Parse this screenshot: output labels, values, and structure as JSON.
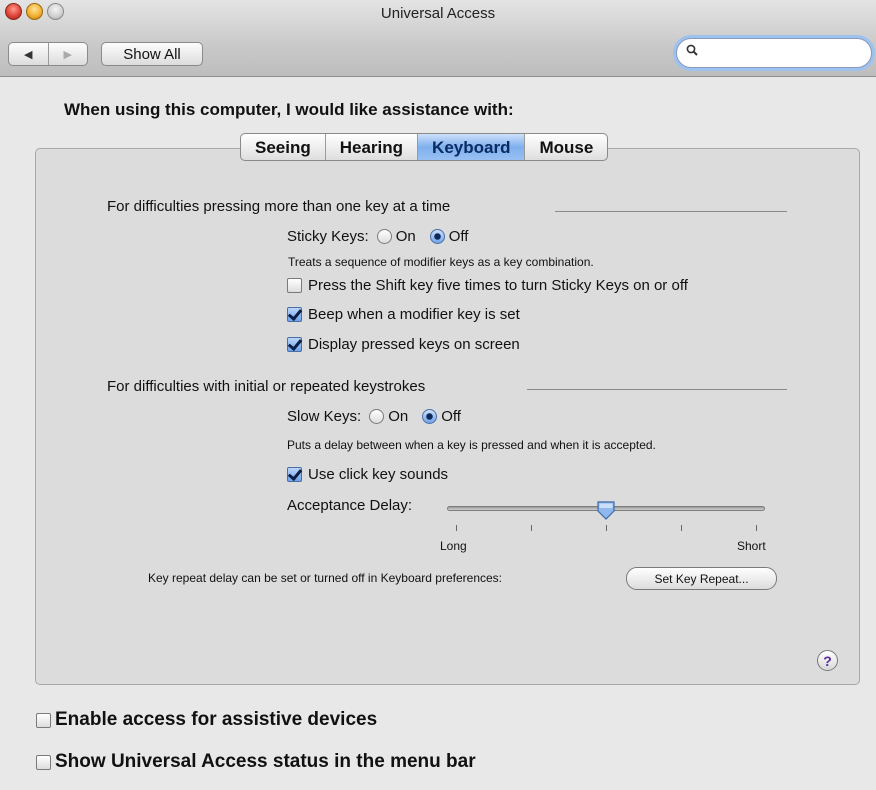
{
  "window": {
    "title": "Universal Access",
    "show_all": "Show All",
    "search": {
      "value": "",
      "placeholder": ""
    }
  },
  "heading": "When using this computer, I would like assistance with:",
  "tabs": [
    {
      "label": "Seeing",
      "selected": false
    },
    {
      "label": "Hearing",
      "selected": false
    },
    {
      "label": "Keyboard",
      "selected": true
    },
    {
      "label": "Mouse",
      "selected": false
    }
  ],
  "sticky": {
    "section_title": "For difficulties pressing more than one key at a time",
    "label": "Sticky Keys:",
    "on": "On",
    "off": "Off",
    "selected": "Off",
    "description": "Treats a sequence of modifier keys as a key combination.",
    "options": [
      {
        "label": "Press the Shift key five times to turn Sticky Keys on or off",
        "checked": false
      },
      {
        "label": "Beep when a modifier key is set",
        "checked": true
      },
      {
        "label": "Display pressed keys on screen",
        "checked": true
      }
    ]
  },
  "slow": {
    "section_title": "For difficulties with initial or repeated keystrokes",
    "label": "Slow Keys:",
    "on": "On",
    "off": "Off",
    "selected": "Off",
    "description": "Puts a delay between when a key is pressed and when it is accepted.",
    "click_sounds": {
      "label": "Use click key sounds",
      "checked": true
    },
    "acceptance_delay": {
      "label": "Acceptance Delay:",
      "min_label": "Long",
      "max_label": "Short",
      "value": 0.5,
      "tick_count": 5
    }
  },
  "key_repeat": {
    "text": "Key repeat delay can be set or turned off in Keyboard preferences:",
    "button": "Set Key Repeat..."
  },
  "help": "?",
  "bottom": [
    {
      "label": "Enable access for assistive devices",
      "checked": false
    },
    {
      "label": "Show Universal Access status in the menu bar",
      "checked": false
    }
  ],
  "colors": {
    "selected_tab": "#7fb0ee",
    "window_bg": "#e8e8e8",
    "search_focus": "#9ec2f0"
  }
}
